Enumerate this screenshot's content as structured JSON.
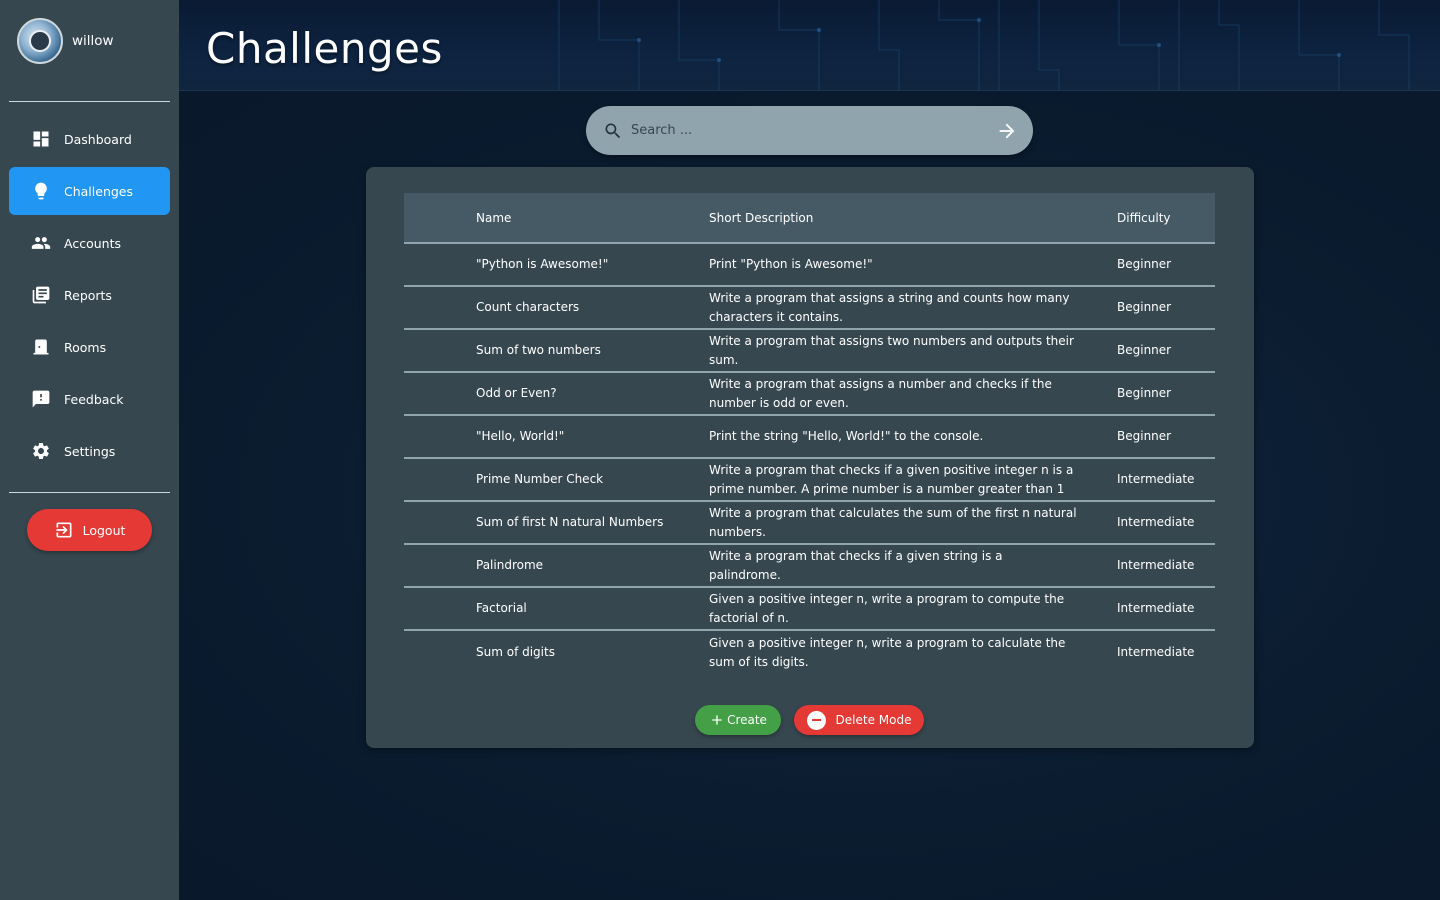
{
  "user": {
    "name": "willow"
  },
  "sidebar": {
    "items": [
      {
        "label": "Dashboard",
        "icon": "dashboard-icon",
        "active": false
      },
      {
        "label": "Challenges",
        "icon": "lightbulb-icon",
        "active": true
      },
      {
        "label": "Accounts",
        "icon": "people-icon",
        "active": false
      },
      {
        "label": "Reports",
        "icon": "library-books-icon",
        "active": false
      },
      {
        "label": "Rooms",
        "icon": "door-icon",
        "active": false
      },
      {
        "label": "Feedback",
        "icon": "feedback-icon",
        "active": false
      },
      {
        "label": "Settings",
        "icon": "gear-icon",
        "active": false
      }
    ],
    "logout_label": "Logout"
  },
  "header": {
    "title": "Challenges"
  },
  "search": {
    "placeholder": "Search ...",
    "value": ""
  },
  "table": {
    "columns": [
      "Name",
      "Short Description",
      "Difficulty"
    ],
    "rows": [
      {
        "name": "\"Python is Awesome!\"",
        "description": "Print \"Python is Awesome!\"",
        "difficulty": "Beginner"
      },
      {
        "name": "Count characters",
        "description": "Write a program that assigns a string and counts how many characters it contains.",
        "difficulty": "Beginner"
      },
      {
        "name": "Sum of two numbers",
        "description": "Write a program that assigns two numbers and outputs their sum.",
        "difficulty": "Beginner"
      },
      {
        "name": "Odd or Even?",
        "description": "Write a program that assigns a number and checks if the number is odd or even.",
        "difficulty": "Beginner"
      },
      {
        "name": "\"Hello, World!\"",
        "description": "Print the string \"Hello, World!\" to the console.",
        "difficulty": "Beginner"
      },
      {
        "name": "Prime Number Check",
        "description": "Write a program that checks if a given positive integer n is a prime number. A prime number is a number greater than 1",
        "difficulty": "Intermediate"
      },
      {
        "name": "Sum of first N natural Numbers",
        "description": "Write a program that calculates the sum of the first n natural numbers.",
        "difficulty": "Intermediate"
      },
      {
        "name": "Palindrome",
        "description": "Write a program that checks if a given string is a palindrome.",
        "difficulty": "Intermediate"
      },
      {
        "name": "Factorial",
        "description": "Given a positive integer n, write a program to compute the factorial of n.",
        "difficulty": "Intermediate"
      },
      {
        "name": "Sum of digits",
        "description": "Given a positive integer n, write a program to calculate the sum of its digits.",
        "difficulty": "Intermediate"
      }
    ]
  },
  "actions": {
    "create_label": "Create",
    "delete_label": "Delete Mode"
  },
  "colors": {
    "sidebar": "#37474f",
    "active": "#2196f3",
    "logout": "#e53935",
    "create": "#43a047",
    "delete": "#e53935"
  }
}
